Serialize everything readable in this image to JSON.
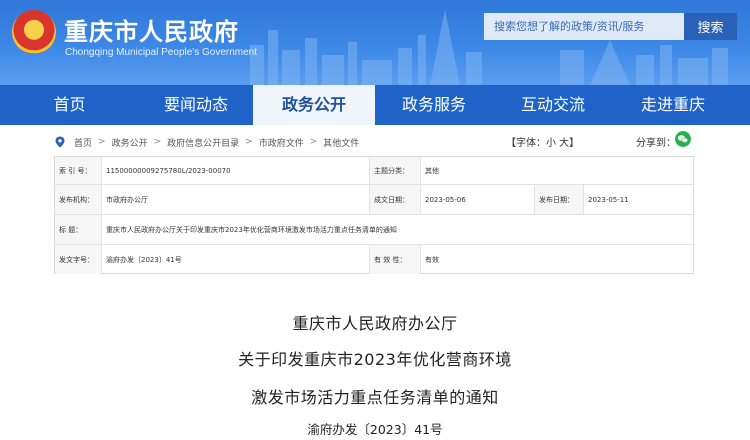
{
  "header": {
    "title": "重庆市人民政府",
    "subtitle": "Chongqing Municipal People's Government",
    "search_placeholder": "搜索您想了解的政策/资讯/服务",
    "search_button": "搜索",
    "emblem_icon": "national-emblem",
    "brand_color": "#2f77d9"
  },
  "nav": {
    "items": [
      {
        "label": "首页"
      },
      {
        "label": "要闻动态"
      },
      {
        "label": "政务公开"
      },
      {
        "label": "政务服务"
      },
      {
        "label": "互动交流"
      },
      {
        "label": "走进重庆"
      }
    ],
    "active_index": 2,
    "color": "#1f63c8"
  },
  "breadcrumb": {
    "icon": "location-pin-icon",
    "items": [
      "首页",
      "政务公开",
      "政府信息公开目录",
      "市政府文件",
      "其他文件"
    ]
  },
  "tools": {
    "font_size": "【字体：小 大】",
    "share": "分享到：",
    "share_icon": "wechat-icon"
  },
  "info": {
    "index_label": "索 引 号：",
    "index_value": "11500000009275780L/2023-00070",
    "topic_label": "主题分类：",
    "topic_value": "其他",
    "issuer_label": "发布机构：",
    "issuer_value": "市政府办公厅",
    "created_label": "成文日期：",
    "created_value": "2023-05-06",
    "published_label": "发布日期：",
    "published_value": "2023-05-11",
    "title_label": "标    题：",
    "title_value": "重庆市人民政府办公厅关于印发重庆市2023年优化营商环境激发市场活力重点任务清单的通知",
    "docno_label": "发文字号：",
    "docno_value": "渝府办发〔2023〕41号",
    "validity_label": "有 效 性：",
    "validity_value": "有效"
  },
  "document": {
    "line1": "重庆市人民政府办公厅",
    "line2": "关于印发重庆市2023年优化营商环境",
    "line3": "激发市场活力重点任务清单的通知",
    "doc_no": "渝府办发〔2023〕41号"
  }
}
